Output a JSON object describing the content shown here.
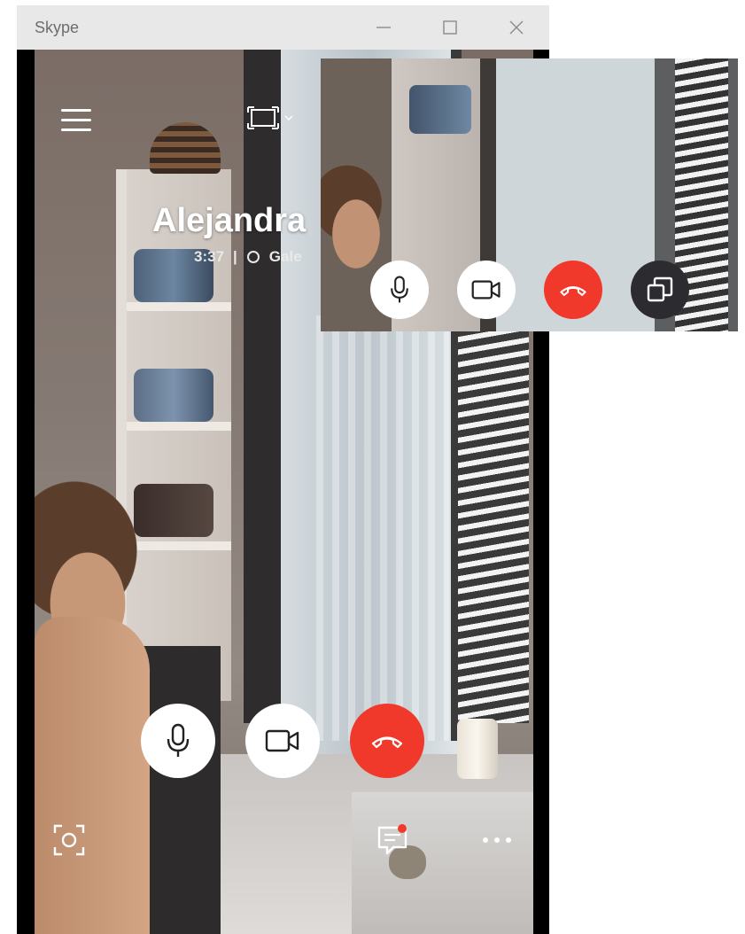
{
  "window": {
    "title": "Skype",
    "controls": {
      "minimize": "minimize",
      "maximize": "maximize",
      "close": "close"
    }
  },
  "call": {
    "caller_name": "Alejandra",
    "duration": "3:37",
    "separator": "|",
    "view_mode_label": "Gale"
  },
  "icons": {
    "menu": "hamburger-menu-icon",
    "layout": "screen-layout-icon",
    "microphone": "microphone-icon",
    "camera": "video-camera-icon",
    "hangup": "hang-up-icon",
    "snapshot": "camera-snapshot-icon",
    "chat": "chat-icon",
    "more": "more-options-icon",
    "popout": "restore-window-icon"
  },
  "colors": {
    "hangup_red": "#f0392b",
    "control_white": "#ffffff",
    "popout_dark": "#2b2b30",
    "titlebar": "#e8e8e8"
  },
  "chat": {
    "has_unread": true
  }
}
